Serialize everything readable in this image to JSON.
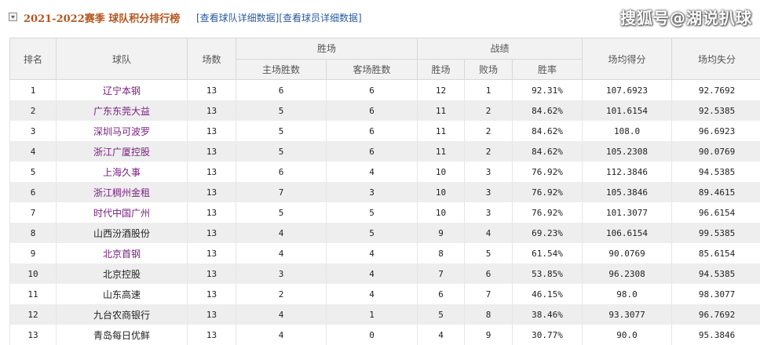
{
  "header": {
    "season_title": "2021-2022赛季  球队积分排行榜",
    "link_team": "[查看球队详细数据]",
    "link_player": "[查看球员详细数据]",
    "watermark": "搜狐号@湖说扒球",
    "icon": "collapse-arrow-icon"
  },
  "table": {
    "group_headers": {
      "wins": "胜场",
      "record": "战绩"
    },
    "columns": {
      "rank": "排名",
      "team": "球队",
      "games": "场数",
      "home_wins": "主场胜数",
      "away_wins": "客场胜数",
      "won": "胜场",
      "lost": "败场",
      "pct": "胜率",
      "ppg": "场均得分",
      "oppg": "场均失分"
    },
    "rows": [
      {
        "rank": "1",
        "team": "辽宁本钢",
        "games": "13",
        "home_wins": "6",
        "away_wins": "6",
        "won": "12",
        "lost": "1",
        "pct": "92.31%",
        "ppg": "107.6923",
        "oppg": "92.7692",
        "linked": true
      },
      {
        "rank": "2",
        "team": "广东东莞大益",
        "games": "13",
        "home_wins": "5",
        "away_wins": "6",
        "won": "11",
        "lost": "2",
        "pct": "84.62%",
        "ppg": "101.6154",
        "oppg": "92.5385",
        "linked": true
      },
      {
        "rank": "3",
        "team": "深圳马可波罗",
        "games": "13",
        "home_wins": "5",
        "away_wins": "6",
        "won": "11",
        "lost": "2",
        "pct": "84.62%",
        "ppg": "108.0",
        "oppg": "96.6923",
        "linked": true
      },
      {
        "rank": "4",
        "team": "浙江广厦控股",
        "games": "13",
        "home_wins": "5",
        "away_wins": "6",
        "won": "11",
        "lost": "2",
        "pct": "84.62%",
        "ppg": "105.2308",
        "oppg": "90.0769",
        "linked": true
      },
      {
        "rank": "5",
        "team": "上海久事",
        "games": "13",
        "home_wins": "6",
        "away_wins": "4",
        "won": "10",
        "lost": "3",
        "pct": "76.92%",
        "ppg": "112.3846",
        "oppg": "94.5385",
        "linked": true
      },
      {
        "rank": "6",
        "team": "浙江稠州金租",
        "games": "13",
        "home_wins": "7",
        "away_wins": "3",
        "won": "10",
        "lost": "3",
        "pct": "76.92%",
        "ppg": "105.3846",
        "oppg": "89.4615",
        "linked": true
      },
      {
        "rank": "7",
        "team": "时代中国广州",
        "games": "13",
        "home_wins": "5",
        "away_wins": "5",
        "won": "10",
        "lost": "3",
        "pct": "76.92%",
        "ppg": "101.3077",
        "oppg": "96.6154",
        "linked": true
      },
      {
        "rank": "8",
        "team": "山西汾酒股份",
        "games": "13",
        "home_wins": "4",
        "away_wins": "5",
        "won": "9",
        "lost": "4",
        "pct": "69.23%",
        "ppg": "106.6154",
        "oppg": "99.5385",
        "linked": false
      },
      {
        "rank": "9",
        "team": "北京首钢",
        "games": "13",
        "home_wins": "4",
        "away_wins": "4",
        "won": "8",
        "lost": "5",
        "pct": "61.54%",
        "ppg": "90.0769",
        "oppg": "85.6154",
        "linked": true
      },
      {
        "rank": "10",
        "team": "北京控股",
        "games": "13",
        "home_wins": "3",
        "away_wins": "4",
        "won": "7",
        "lost": "6",
        "pct": "53.85%",
        "ppg": "96.2308",
        "oppg": "94.5385",
        "linked": false
      },
      {
        "rank": "11",
        "team": "山东高速",
        "games": "13",
        "home_wins": "2",
        "away_wins": "4",
        "won": "6",
        "lost": "7",
        "pct": "46.15%",
        "ppg": "98.0",
        "oppg": "98.3077",
        "linked": false
      },
      {
        "rank": "12",
        "team": "九台农商银行",
        "games": "13",
        "home_wins": "4",
        "away_wins": "1",
        "won": "5",
        "lost": "8",
        "pct": "38.46%",
        "ppg": "93.3077",
        "oppg": "96.7692",
        "linked": false
      },
      {
        "rank": "13",
        "team": "青岛每日优鲜",
        "games": "13",
        "home_wins": "4",
        "away_wins": "0",
        "won": "4",
        "lost": "9",
        "pct": "30.77%",
        "ppg": "90.0",
        "oppg": "95.3846",
        "linked": false
      }
    ]
  },
  "colors": {
    "title": "#b5561d",
    "link": "#2a5aa0",
    "team_link": "#7a1f82",
    "header_bg": "#f2f2f2",
    "stripe_bg": "#eeeeee"
  }
}
